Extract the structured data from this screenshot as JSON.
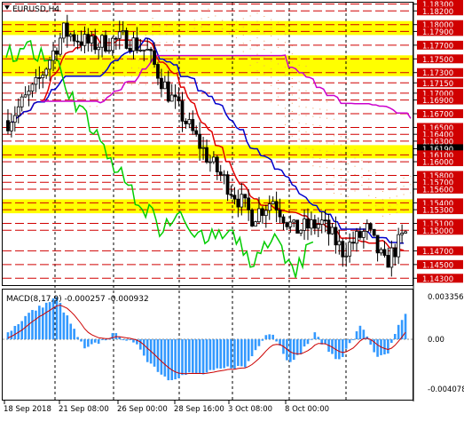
{
  "window": {
    "symbol_label": "EURUSD,H4",
    "indicator_label": "MACD(8,17,9) -0.000257 -0.000932"
  },
  "chart_data": {
    "type": "candlestick",
    "symbol": "EURUSD",
    "timeframe": "H4",
    "ylim": [
      1.142,
      1.1832
    ],
    "price_labels": [
      "1.18300",
      "1.18200",
      "1.18000",
      "1.17900",
      "1.17700",
      "1.17500",
      "1.17300",
      "1.17150",
      "1.17000",
      "1.16900",
      "1.16700",
      "1.16500",
      "1.16400",
      "1.16300",
      "1.16190",
      "1.16100",
      "1.16000",
      "1.15800",
      "1.15700",
      "1.15600",
      "1.15400",
      "1.15300",
      "1.15100",
      "1.15000",
      "1.14700",
      "1.14500",
      "1.14300"
    ],
    "resistance_zones": [
      [
        1.179,
        1.18
      ],
      [
        1.173,
        1.175
      ],
      [
        1.161,
        1.1619
      ],
      [
        1.153,
        1.154
      ]
    ],
    "current_price": "1.16190",
    "date_labels": [
      "18 Sep 2018",
      "21 Sep 08:00",
      "26 Sep 00:00",
      "28 Sep 16:00",
      "3 Oct 08:00",
      "8 Oct 00:00"
    ],
    "macd": {
      "params": "8,17,9",
      "main": "-0.000257",
      "signal": "-0.000932",
      "scale_labels": [
        "0.003356",
        "0.00",
        "-0.004078"
      ],
      "ylim": [
        -0.004078,
        0.003356
      ]
    },
    "colors": {
      "support_resistance": "#d00000",
      "zones": "#ffff00",
      "kijun": "#0000cc",
      "tenkan": "#e00000",
      "chikou": "#00cc00",
      "senkou_b": "#cc00cc",
      "cloud": "#f0a060",
      "macd_hist": "#3399ff",
      "macd_signal": "#cc0000"
    }
  }
}
